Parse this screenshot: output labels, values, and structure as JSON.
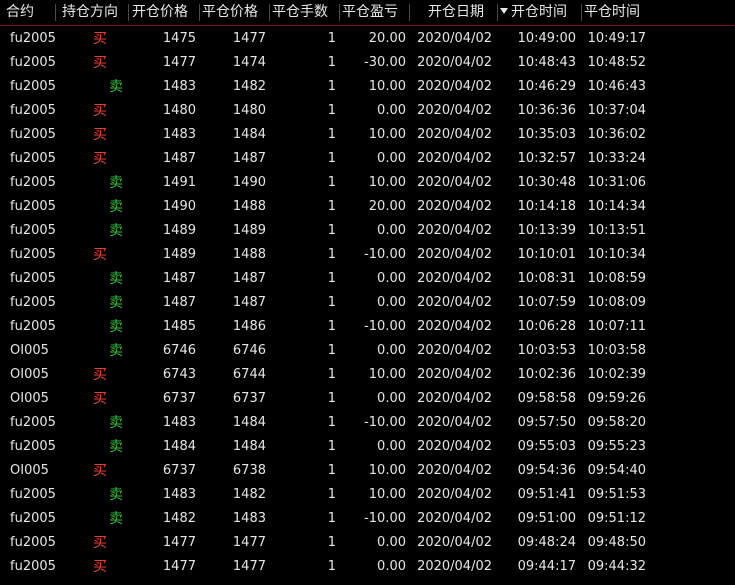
{
  "colors": {
    "background": "#000000",
    "buy": "#e8413a",
    "sell": "#2fbf3a",
    "header_border": "#7a1414",
    "text": "#e6e6e6"
  },
  "header": {
    "contract": "合约",
    "direction": "持仓方向",
    "open_price": "开仓价格",
    "close_price": "平仓价格",
    "quantity": "平仓手数",
    "pnl": "平仓盈亏",
    "open_date": "开仓日期",
    "open_time": "开仓时间",
    "close_time": "平仓时间",
    "sort_icon": "sort-descending-icon"
  },
  "rows": [
    {
      "contract": "fu2005",
      "dir": "买",
      "side": "buy",
      "open": "1475",
      "close": "1477",
      "qty": "1",
      "pnl": "20.00",
      "date": "2020/04/02",
      "otime": "10:49:00",
      "ctime": "10:49:17"
    },
    {
      "contract": "fu2005",
      "dir": "买",
      "side": "buy",
      "open": "1477",
      "close": "1474",
      "qty": "1",
      "pnl": "-30.00",
      "date": "2020/04/02",
      "otime": "10:48:43",
      "ctime": "10:48:52"
    },
    {
      "contract": "fu2005",
      "dir": "卖",
      "side": "sell",
      "open": "1483",
      "close": "1482",
      "qty": "1",
      "pnl": "10.00",
      "date": "2020/04/02",
      "otime": "10:46:29",
      "ctime": "10:46:43"
    },
    {
      "contract": "fu2005",
      "dir": "买",
      "side": "buy",
      "open": "1480",
      "close": "1480",
      "qty": "1",
      "pnl": "0.00",
      "date": "2020/04/02",
      "otime": "10:36:36",
      "ctime": "10:37:04"
    },
    {
      "contract": "fu2005",
      "dir": "买",
      "side": "buy",
      "open": "1483",
      "close": "1484",
      "qty": "1",
      "pnl": "10.00",
      "date": "2020/04/02",
      "otime": "10:35:03",
      "ctime": "10:36:02"
    },
    {
      "contract": "fu2005",
      "dir": "买",
      "side": "buy",
      "open": "1487",
      "close": "1487",
      "qty": "1",
      "pnl": "0.00",
      "date": "2020/04/02",
      "otime": "10:32:57",
      "ctime": "10:33:24"
    },
    {
      "contract": "fu2005",
      "dir": "卖",
      "side": "sell",
      "open": "1491",
      "close": "1490",
      "qty": "1",
      "pnl": "10.00",
      "date": "2020/04/02",
      "otime": "10:30:48",
      "ctime": "10:31:06"
    },
    {
      "contract": "fu2005",
      "dir": "卖",
      "side": "sell",
      "open": "1490",
      "close": "1488",
      "qty": "1",
      "pnl": "20.00",
      "date": "2020/04/02",
      "otime": "10:14:18",
      "ctime": "10:14:34"
    },
    {
      "contract": "fu2005",
      "dir": "卖",
      "side": "sell",
      "open": "1489",
      "close": "1489",
      "qty": "1",
      "pnl": "0.00",
      "date": "2020/04/02",
      "otime": "10:13:39",
      "ctime": "10:13:51"
    },
    {
      "contract": "fu2005",
      "dir": "买",
      "side": "buy",
      "open": "1489",
      "close": "1488",
      "qty": "1",
      "pnl": "-10.00",
      "date": "2020/04/02",
      "otime": "10:10:01",
      "ctime": "10:10:34"
    },
    {
      "contract": "fu2005",
      "dir": "卖",
      "side": "sell",
      "open": "1487",
      "close": "1487",
      "qty": "1",
      "pnl": "0.00",
      "date": "2020/04/02",
      "otime": "10:08:31",
      "ctime": "10:08:59"
    },
    {
      "contract": "fu2005",
      "dir": "卖",
      "side": "sell",
      "open": "1487",
      "close": "1487",
      "qty": "1",
      "pnl": "0.00",
      "date": "2020/04/02",
      "otime": "10:07:59",
      "ctime": "10:08:09"
    },
    {
      "contract": "fu2005",
      "dir": "卖",
      "side": "sell",
      "open": "1485",
      "close": "1486",
      "qty": "1",
      "pnl": "-10.00",
      "date": "2020/04/02",
      "otime": "10:06:28",
      "ctime": "10:07:11"
    },
    {
      "contract": "OI005",
      "dir": "卖",
      "side": "sell",
      "open": "6746",
      "close": "6746",
      "qty": "1",
      "pnl": "0.00",
      "date": "2020/04/02",
      "otime": "10:03:53",
      "ctime": "10:03:58"
    },
    {
      "contract": "OI005",
      "dir": "买",
      "side": "buy",
      "open": "6743",
      "close": "6744",
      "qty": "1",
      "pnl": "10.00",
      "date": "2020/04/02",
      "otime": "10:02:36",
      "ctime": "10:02:39"
    },
    {
      "contract": "OI005",
      "dir": "买",
      "side": "buy",
      "open": "6737",
      "close": "6737",
      "qty": "1",
      "pnl": "0.00",
      "date": "2020/04/02",
      "otime": "09:58:58",
      "ctime": "09:59:26"
    },
    {
      "contract": "fu2005",
      "dir": "卖",
      "side": "sell",
      "open": "1483",
      "close": "1484",
      "qty": "1",
      "pnl": "-10.00",
      "date": "2020/04/02",
      "otime": "09:57:50",
      "ctime": "09:58:20"
    },
    {
      "contract": "fu2005",
      "dir": "卖",
      "side": "sell",
      "open": "1484",
      "close": "1484",
      "qty": "1",
      "pnl": "0.00",
      "date": "2020/04/02",
      "otime": "09:55:03",
      "ctime": "09:55:23"
    },
    {
      "contract": "OI005",
      "dir": "买",
      "side": "buy",
      "open": "6737",
      "close": "6738",
      "qty": "1",
      "pnl": "10.00",
      "date": "2020/04/02",
      "otime": "09:54:36",
      "ctime": "09:54:40"
    },
    {
      "contract": "fu2005",
      "dir": "卖",
      "side": "sell",
      "open": "1483",
      "close": "1482",
      "qty": "1",
      "pnl": "10.00",
      "date": "2020/04/02",
      "otime": "09:51:41",
      "ctime": "09:51:53"
    },
    {
      "contract": "fu2005",
      "dir": "卖",
      "side": "sell",
      "open": "1482",
      "close": "1483",
      "qty": "1",
      "pnl": "-10.00",
      "date": "2020/04/02",
      "otime": "09:51:00",
      "ctime": "09:51:12"
    },
    {
      "contract": "fu2005",
      "dir": "买",
      "side": "buy",
      "open": "1477",
      "close": "1477",
      "qty": "1",
      "pnl": "0.00",
      "date": "2020/04/02",
      "otime": "09:48:24",
      "ctime": "09:48:50"
    },
    {
      "contract": "fu2005",
      "dir": "买",
      "side": "buy",
      "open": "1477",
      "close": "1477",
      "qty": "1",
      "pnl": "0.00",
      "date": "2020/04/02",
      "otime": "09:44:17",
      "ctime": "09:44:32"
    }
  ]
}
